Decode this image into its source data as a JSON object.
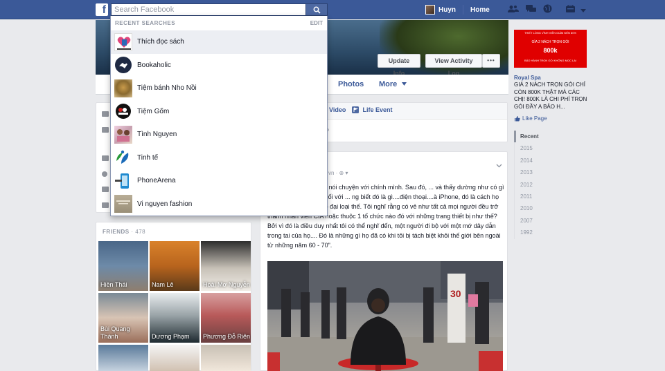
{
  "topbar": {
    "logo": "f",
    "search_placeholder": "Search Facebook",
    "user_name": "Huyn",
    "home_label": "Home"
  },
  "cover": {
    "update_info": "Update Info",
    "view_activity_log": "View Activity Log",
    "more_dots": "•••"
  },
  "tabs": {
    "photos": "Photos",
    "more": "More"
  },
  "composer": {
    "video_label": "/ Video",
    "life_event_label": "Life Event",
    "prompt": "d?"
  },
  "post": {
    "time": "vn · ⊕ ▾",
    "text": "...hết mọi người đang nói chuyện với chính mình. Sau đó, ... và thấy dường như có gì đó nhét trong tai họ, nối với ... ng biết đó là gì....điện thoại....à iPhone, đó là cách họ gọi nó, hoặc thứ gì đó đại loại thế. Tôi nghĩ rằng có vẻ như tất cả mọi người đều trở thành nhân viên CIA hoặc thuộc 1 tổ chức nào đó với những trang thiết bị như thế? Bởi vì đó là điều duy nhất tôi có thể nghĩ đến, một người đi bộ với một mớ dây dẫn trong tai của họ.... Đó là những gì họ đã có khi tôi bị tách biệt khỏi thế giới bên ngoài từ những năm 60 - 70\"."
  },
  "friends": {
    "title": "FRIENDS",
    "count": "· 478",
    "list": [
      {
        "name": "Hiền Thái"
      },
      {
        "name": "Nam Lê"
      },
      {
        "name": "Hoài Mơ Nguyễn"
      },
      {
        "name": "Bùi Quang Thành"
      },
      {
        "name": "Dương Phạm"
      },
      {
        "name": "Phương Đỗ Riên"
      }
    ]
  },
  "ad": {
    "banner_line1": "THIẾT LÒNG VÌNH VIỄN GIẢM ĐẾN 80%",
    "banner_line2": "GÌA 2 NÁCH TRỌN GÓI",
    "banner_price": "800k",
    "banner_line3": "BẢO HÀNH TRỌN GÓI KHÔNG MỌC LẠI",
    "sponsor": "Royal Spa",
    "body": "GIÁ 2 NÁCH TRỌN GÓI CHỈ CÒN 800K THẬT MÀ CÁC CHỊ! 800K LÀ CHI PHÍ TRỌN GÓI ĐẦY A BẢO H...",
    "like_label": "Like Page"
  },
  "timeline_years": [
    "Recent",
    "2015",
    "2014",
    "2013",
    "2012",
    "2011",
    "2010",
    "2007",
    "1992"
  ],
  "search_dropdown": {
    "title": "RECENT SEARCHES",
    "edit": "EDIT",
    "items": [
      {
        "label": "Thích đọc sách"
      },
      {
        "label": "Bookaholic"
      },
      {
        "label": "Tiệm bánh Nho Nồi"
      },
      {
        "label": "Tiệm Gốm"
      },
      {
        "label": "Tình Nguyen"
      },
      {
        "label": "Tinh tế"
      },
      {
        "label": "PhoneArena"
      },
      {
        "label": "Vi nguyen fashion"
      }
    ]
  },
  "colors": {
    "brand": "#3b5998",
    "ad_red": "#e00000"
  }
}
